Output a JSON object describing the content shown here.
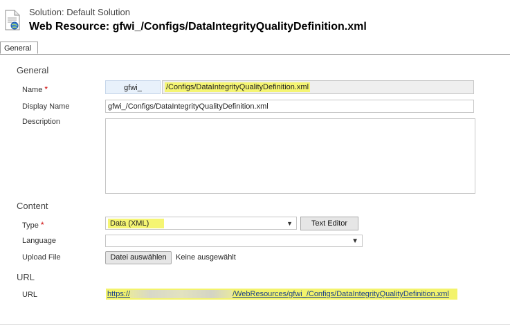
{
  "header": {
    "solution": "Solution: Default Solution",
    "title": "Web Resource: gfwi_/Configs/DataIntegrityQualityDefinition.xml"
  },
  "tabs": [
    {
      "label": "General"
    }
  ],
  "sections": {
    "general": "General",
    "content": "Content",
    "url": "URL"
  },
  "fields": {
    "name": {
      "label": "Name",
      "required": "*",
      "prefix": "gfwi_",
      "value": "/Configs/DataIntegrityQualityDefinition.xml"
    },
    "display_name": {
      "label": "Display Name",
      "value": "gfwi_/Configs/DataIntegrityQualityDefinition.xml"
    },
    "description": {
      "label": "Description",
      "value": ""
    },
    "type": {
      "label": "Type",
      "required": "*",
      "value": "Data (XML)"
    },
    "language": {
      "label": "Language",
      "value": ""
    },
    "upload": {
      "label": "Upload File",
      "button": "Datei auswählen",
      "status": "Keine ausgewählt"
    },
    "url": {
      "label": "URL",
      "prefix": "https://",
      "suffix": "/WebResources/gfwi_/Configs/DataIntegrityQualityDefinition.xml"
    }
  },
  "buttons": {
    "text_editor": "Text Editor"
  },
  "colors": {
    "highlight": "#f5f573",
    "required": "#cc0000",
    "link": "#1a3f8a"
  }
}
